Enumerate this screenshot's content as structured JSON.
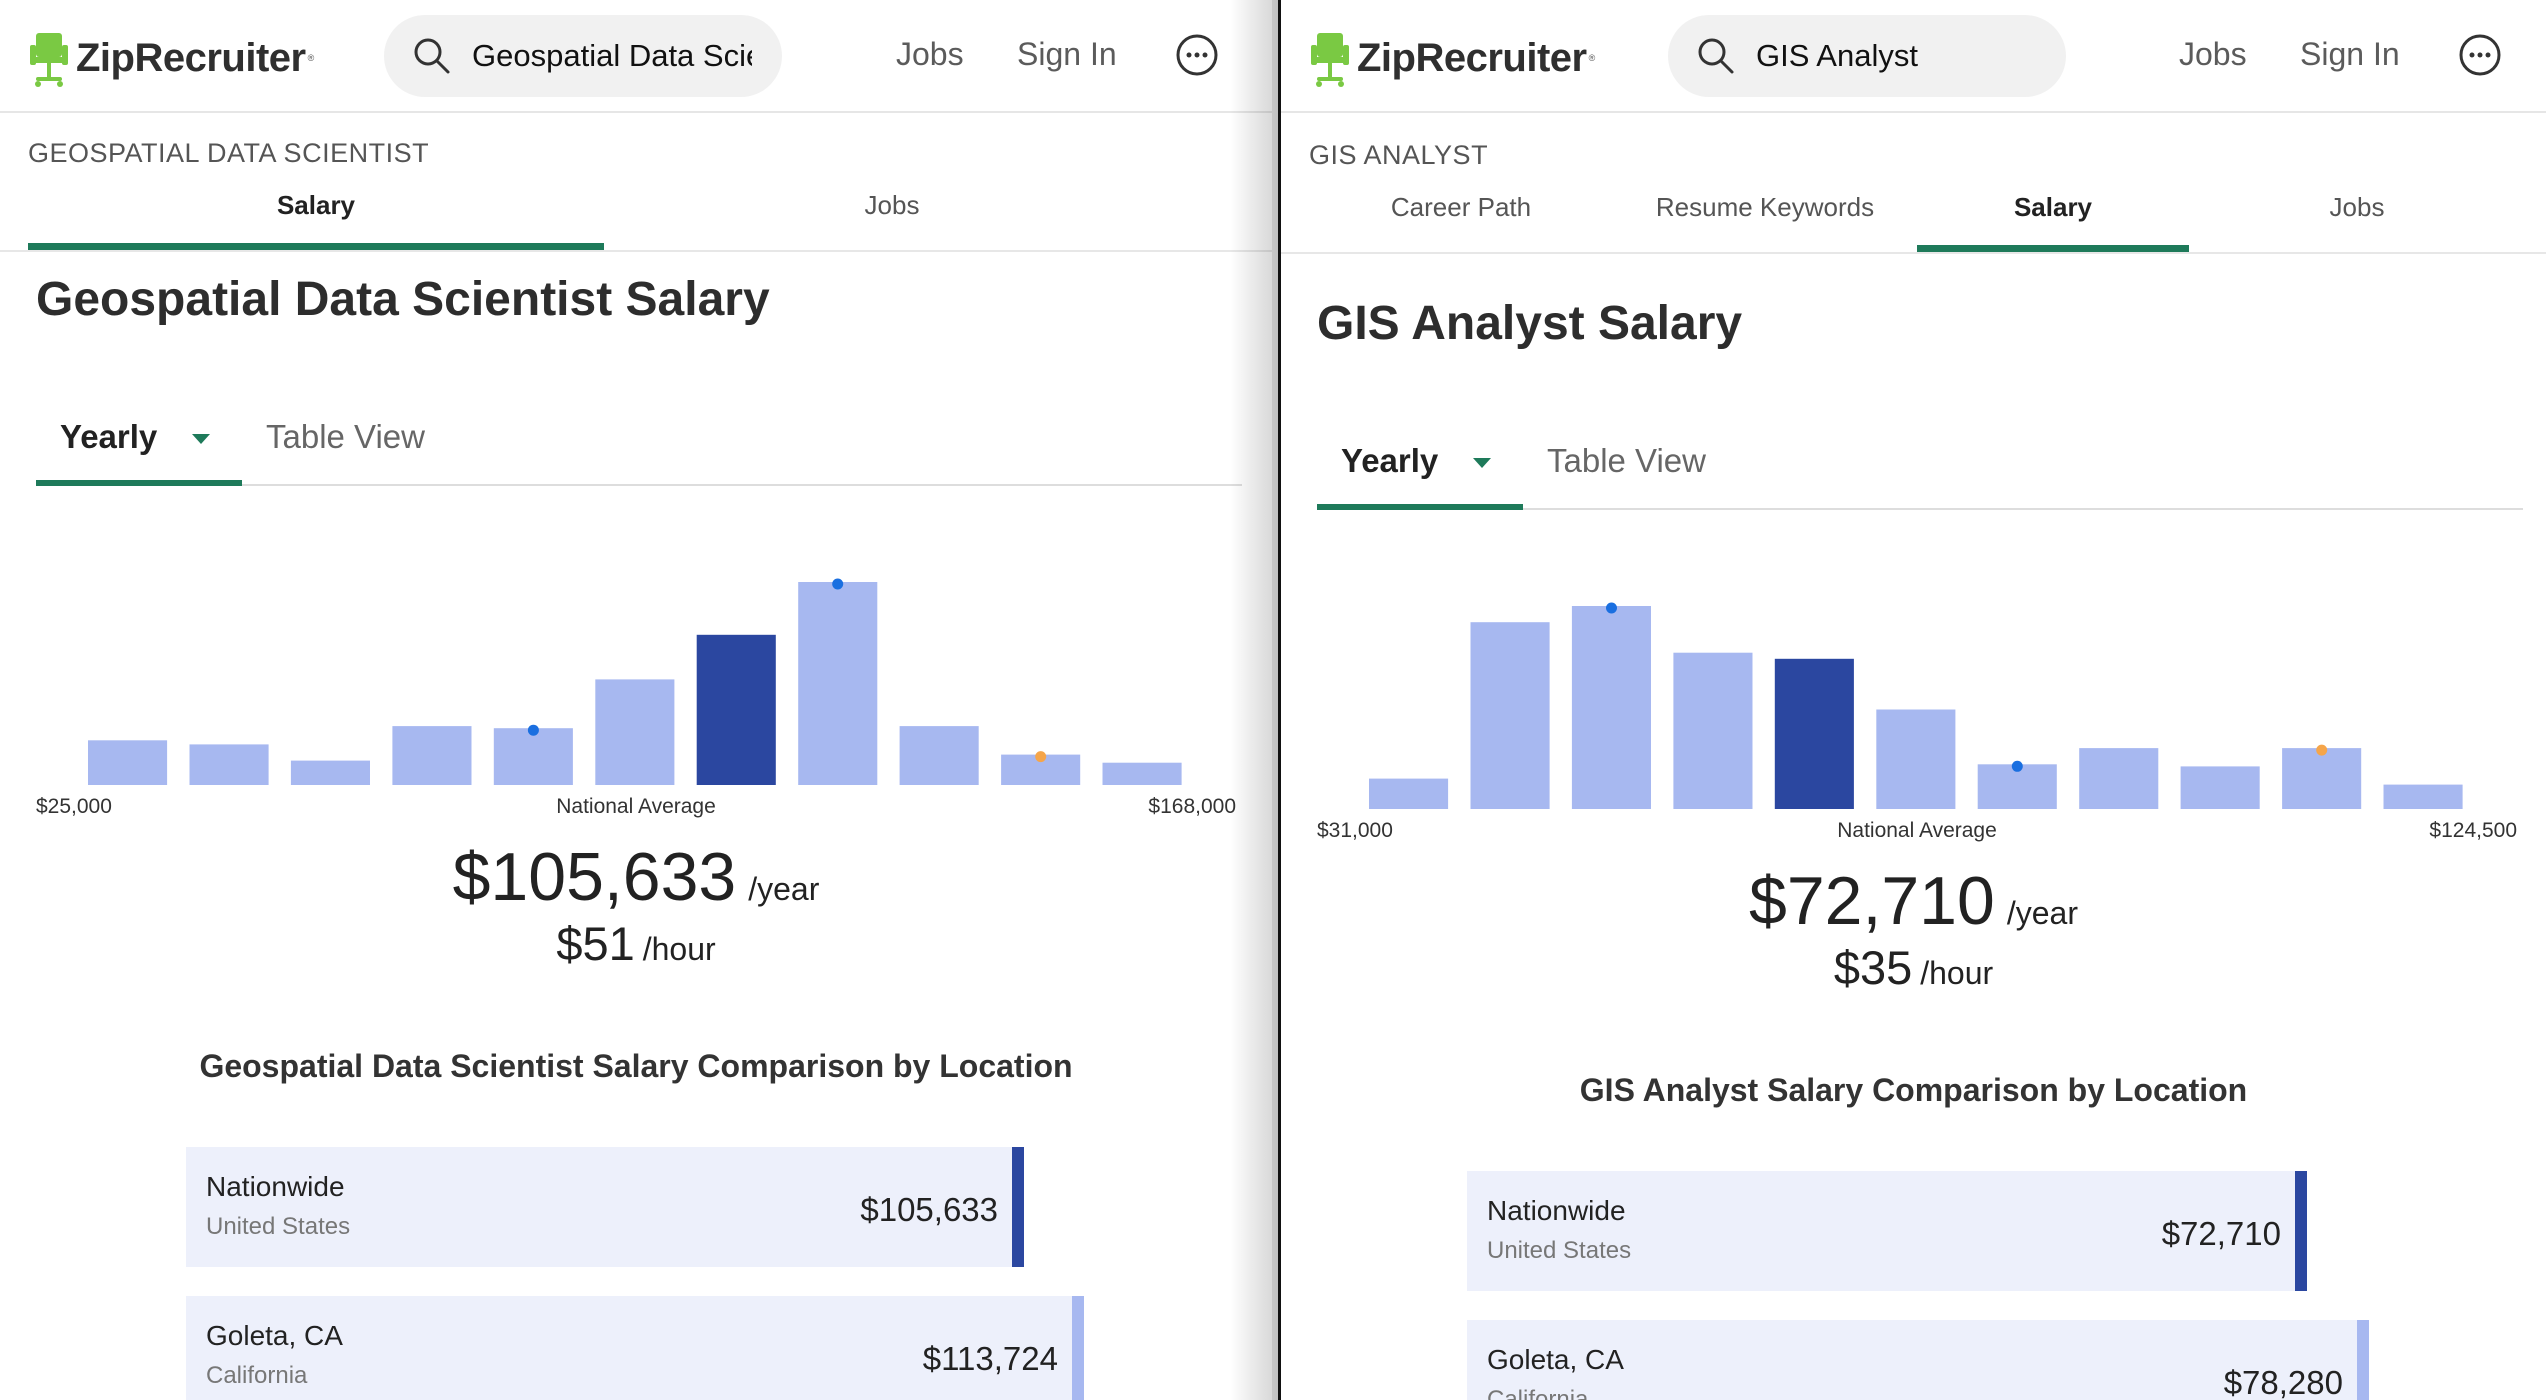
{
  "brand": {
    "name": "ZipRecruiter",
    "green": "#7ac943",
    "accent": "#1e7a5a",
    "bar_light": "#a7b8f0",
    "bar_dark": "#2b47a0"
  },
  "left": {
    "search_value": "Geospatial Data Scie",
    "nav": {
      "jobs": "Jobs",
      "signin": "Sign In"
    },
    "crumb": "GEOSPATIAL DATA SCIENTIST",
    "tabs": [
      {
        "label": "Salary",
        "active": true
      },
      {
        "label": "Jobs",
        "active": false
      }
    ],
    "title": "Geospatial Data Scientist Salary",
    "view": {
      "yearly": "Yearly",
      "table": "Table View"
    },
    "chart_data": {
      "type": "bar",
      "title": "",
      "bins": 11,
      "values": [
        0.22,
        0.2,
        0.12,
        0.29,
        0.28,
        0.52,
        0.74,
        1.0,
        0.29,
        0.15,
        0.11
      ],
      "highlight_index": 6,
      "marker_blue": [
        4,
        7
      ],
      "marker_orange": [
        9
      ],
      "x_min_label": "$25,000",
      "x_mid_label": "National Average",
      "x_max_label": "$168,000"
    },
    "avg_year": "$105,633",
    "avg_year_unit": "/year",
    "avg_hour": "$51",
    "avg_hour_unit": "/hour",
    "comparison_title": "Geospatial Data Scientist Salary Comparison by Location",
    "locations": [
      {
        "name": "Nationwide",
        "state": "United States",
        "value": "$105,633",
        "bar_color": "#2b47a0"
      },
      {
        "name": "Goleta, CA",
        "state": "California",
        "value": "$113,724",
        "bar_color": "#a7b8f0"
      }
    ]
  },
  "right": {
    "search_value": "GIS Analyst",
    "nav": {
      "jobs": "Jobs",
      "signin": "Sign In"
    },
    "crumb": "GIS ANALYST",
    "tabs": [
      {
        "label": "Career Path",
        "active": false
      },
      {
        "label": "Resume Keywords",
        "active": false
      },
      {
        "label": "Salary",
        "active": true
      },
      {
        "label": "Jobs",
        "active": false
      }
    ],
    "title": "GIS Analyst Salary",
    "view": {
      "yearly": "Yearly",
      "table": "Table View"
    },
    "chart_data": {
      "type": "bar",
      "title": "",
      "bins": 11,
      "values": [
        0.15,
        0.92,
        1.0,
        0.77,
        0.74,
        0.49,
        0.22,
        0.3,
        0.21,
        0.3,
        0.12
      ],
      "highlight_index": 4,
      "marker_blue": [
        2,
        6
      ],
      "marker_orange": [
        9
      ],
      "x_min_label": "$31,000",
      "x_mid_label": "National Average",
      "x_max_label": "$124,500"
    },
    "avg_year": "$72,710",
    "avg_year_unit": "/year",
    "avg_hour": "$35",
    "avg_hour_unit": "/hour",
    "comparison_title": "GIS Analyst Salary Comparison by Location",
    "locations": [
      {
        "name": "Nationwide",
        "state": "United States",
        "value": "$72,710",
        "bar_color": "#2b47a0"
      },
      {
        "name": "Goleta, CA",
        "state": "California",
        "value": "$78,280",
        "bar_color": "#a7b8f0"
      }
    ]
  }
}
